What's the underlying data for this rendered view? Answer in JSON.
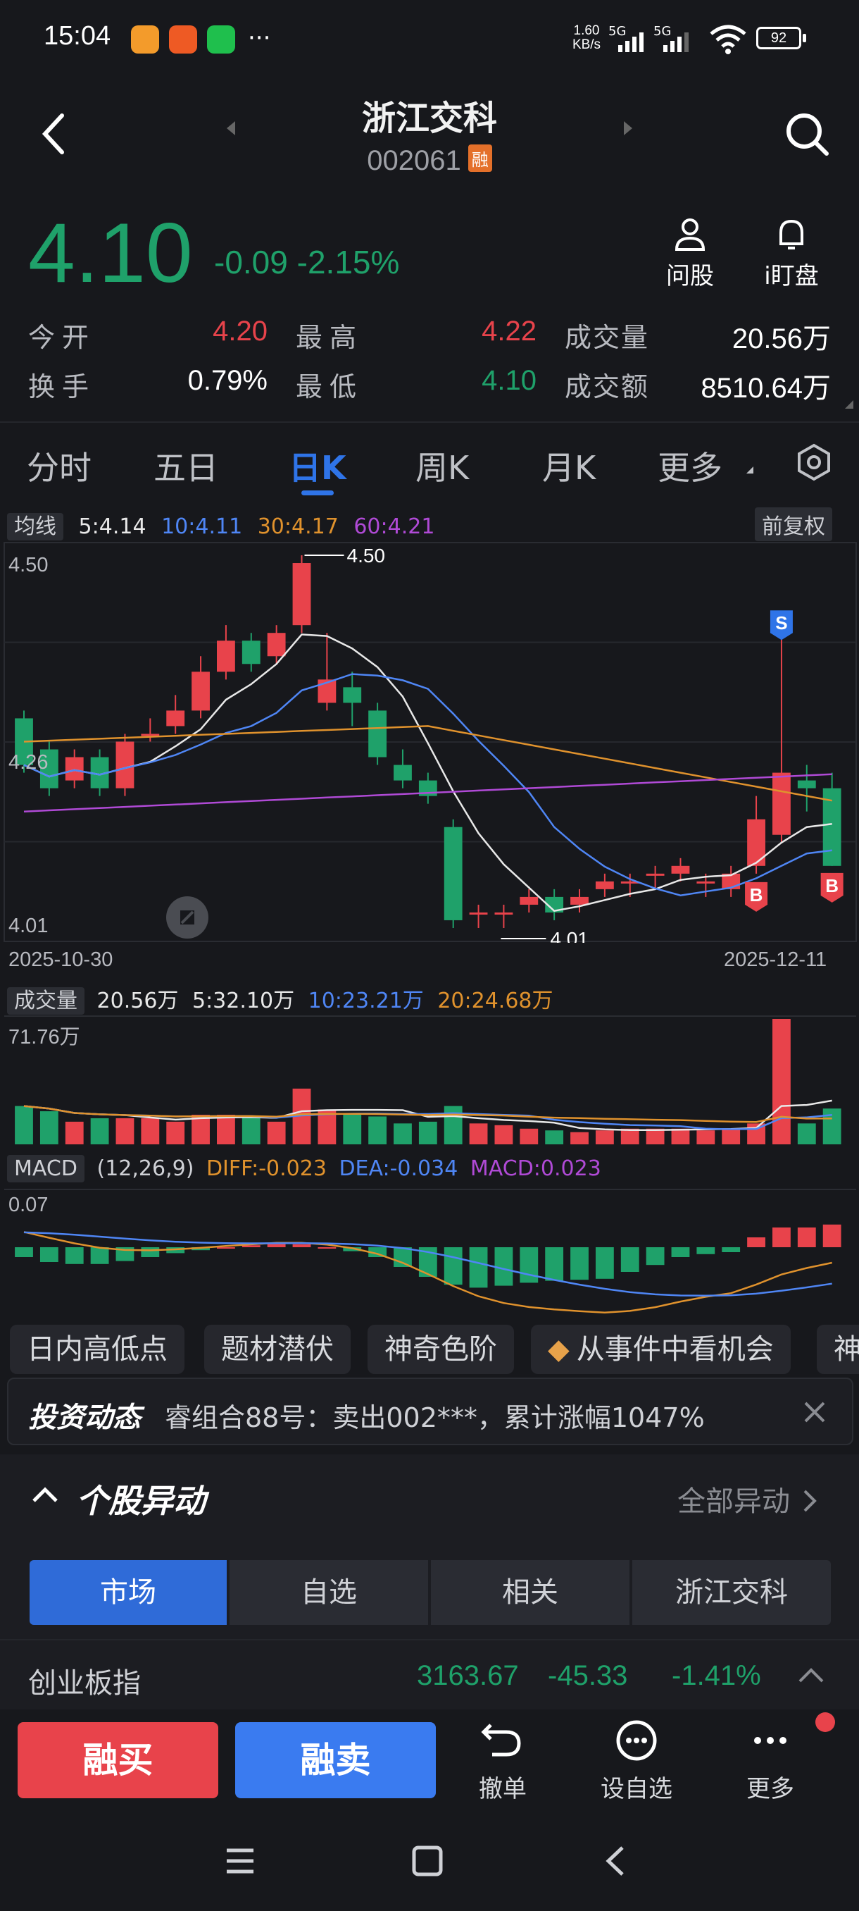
{
  "status_bar": {
    "time": "15:04",
    "more": "···",
    "net_speed_value": "1.60",
    "net_speed_unit": "KB/s",
    "signal1": "5G",
    "signal2": "5G",
    "battery": "92"
  },
  "header": {
    "stock_name": "浙江交科",
    "stock_code": "002061",
    "badge": "融"
  },
  "quote": {
    "price": "4.10",
    "change": "-0.09",
    "change_pct": "-2.15%",
    "ask_label": "问股",
    "watch_label": "i盯盘",
    "open_label": "今开",
    "open_value": "4.20",
    "high_label": "最高",
    "high_value": "4.22",
    "volume_label": "成交量",
    "volume_value": "20.56万",
    "turnover_label": "换手",
    "turnover_value": "0.79%",
    "low_label": "最低",
    "low_value": "4.10",
    "amount_label": "成交额",
    "amount_value": "8510.64万"
  },
  "period_tabs": [
    "分时",
    "五日",
    "日K",
    "周K",
    "月K",
    "更多"
  ],
  "active_tab": 2,
  "kline_bar": {
    "ma_chip": "均线",
    "ma5": "5:4.14",
    "ma10": "10:4.11",
    "ma30": "30:4.17",
    "ma60": "60:4.21",
    "adjust": "前复权"
  },
  "volume_bar": {
    "chip": "成交量",
    "vol": "20.56万",
    "v5": "5:32.10万",
    "v10": "10:23.21万",
    "v20": "20:24.68万",
    "max_label": "71.76万"
  },
  "macd_bar": {
    "chip": "MACD",
    "params": "(12,26,9)",
    "diff": "DIFF:-0.023",
    "dea": "DEA:-0.034",
    "macd": "MACD:0.023",
    "top_label": "0.07"
  },
  "chart_data": {
    "type": "candlestick",
    "title": "",
    "x_start": "2025-10-30",
    "x_end": "2025-12-11",
    "y_ticks": [
      "4.50",
      "4.26",
      "4.01"
    ],
    "ylim": [
      4.01,
      4.5
    ],
    "max_marker": "4.50",
    "min_marker": "4.01",
    "markers": [
      "S",
      "B",
      "B"
    ],
    "candles": [
      {
        "o": 4.29,
        "c": 4.23,
        "h": 4.3,
        "l": 4.22
      },
      {
        "o": 4.25,
        "c": 4.2,
        "h": 4.26,
        "l": 4.19
      },
      {
        "o": 4.21,
        "c": 4.24,
        "h": 4.25,
        "l": 4.2
      },
      {
        "o": 4.24,
        "c": 4.2,
        "h": 4.25,
        "l": 4.19
      },
      {
        "o": 4.2,
        "c": 4.26,
        "h": 4.27,
        "l": 4.19
      },
      {
        "o": 4.27,
        "c": 4.27,
        "h": 4.29,
        "l": 4.26
      },
      {
        "o": 4.28,
        "c": 4.3,
        "h": 4.32,
        "l": 4.27
      },
      {
        "o": 4.3,
        "c": 4.35,
        "h": 4.37,
        "l": 4.29
      },
      {
        "o": 4.35,
        "c": 4.39,
        "h": 4.41,
        "l": 4.34
      },
      {
        "o": 4.39,
        "c": 4.36,
        "h": 4.4,
        "l": 4.35
      },
      {
        "o": 4.37,
        "c": 4.4,
        "h": 4.41,
        "l": 4.36
      },
      {
        "o": 4.41,
        "c": 4.49,
        "h": 4.5,
        "l": 4.4
      },
      {
        "o": 4.31,
        "c": 4.34,
        "h": 4.4,
        "l": 4.3
      },
      {
        "o": 4.33,
        "c": 4.31,
        "h": 4.35,
        "l": 4.28
      },
      {
        "o": 4.3,
        "c": 4.24,
        "h": 4.31,
        "l": 4.23
      },
      {
        "o": 4.23,
        "c": 4.21,
        "h": 4.25,
        "l": 4.2
      },
      {
        "o": 4.21,
        "c": 4.19,
        "h": 4.22,
        "l": 4.18
      },
      {
        "o": 4.15,
        "c": 4.03,
        "h": 4.16,
        "l": 4.02
      },
      {
        "o": 4.04,
        "c": 4.04,
        "h": 4.05,
        "l": 4.02
      },
      {
        "o": 4.04,
        "c": 4.04,
        "h": 4.05,
        "l": 4.02
      },
      {
        "o": 4.05,
        "c": 4.06,
        "h": 4.07,
        "l": 4.04
      },
      {
        "o": 4.06,
        "c": 4.04,
        "h": 4.07,
        "l": 4.03
      },
      {
        "o": 4.05,
        "c": 4.06,
        "h": 4.07,
        "l": 4.04
      },
      {
        "o": 4.07,
        "c": 4.08,
        "h": 4.09,
        "l": 4.06
      },
      {
        "o": 4.08,
        "c": 4.08,
        "h": 4.09,
        "l": 4.06
      },
      {
        "o": 4.09,
        "c": 4.09,
        "h": 4.1,
        "l": 4.07
      },
      {
        "o": 4.09,
        "c": 4.1,
        "h": 4.11,
        "l": 4.08
      },
      {
        "o": 4.08,
        "c": 4.08,
        "h": 4.09,
        "l": 4.06
      },
      {
        "o": 4.07,
        "c": 4.09,
        "h": 4.1,
        "l": 4.06
      },
      {
        "o": 4.1,
        "c": 4.16,
        "h": 4.19,
        "l": 4.09
      },
      {
        "o": 4.14,
        "c": 4.22,
        "h": 4.4,
        "l": 4.13
      },
      {
        "o": 4.21,
        "c": 4.2,
        "h": 4.23,
        "l": 4.17
      },
      {
        "o": 4.2,
        "c": 4.1,
        "h": 4.22,
        "l": 4.1
      }
    ],
    "volumes": [
      22,
      19,
      13,
      15,
      15,
      15,
      13,
      17,
      17,
      16,
      13,
      32,
      20,
      18,
      16,
      12,
      13,
      22,
      12,
      11,
      9,
      8,
      7,
      8,
      9,
      9,
      9,
      8,
      9,
      12,
      72,
      12,
      20.56
    ],
    "macd_hist": [
      -0.01,
      -0.015,
      -0.017,
      -0.017,
      -0.014,
      -0.01,
      -0.006,
      -0.003,
      0.0,
      0.002,
      0.004,
      0.003,
      0.0,
      -0.004,
      -0.01,
      -0.02,
      -0.03,
      -0.038,
      -0.041,
      -0.039,
      -0.036,
      -0.034,
      -0.033,
      -0.032,
      -0.025,
      -0.018,
      -0.01,
      -0.007,
      -0.005,
      0.01,
      0.02,
      0.02,
      0.023
    ]
  },
  "features": [
    "日内高低点",
    "题材潜伏",
    "神奇色阶",
    "从事件中看机会",
    "神"
  ],
  "news": {
    "tag": "投资动态",
    "text": "睿组合88号：卖出002***，累计涨幅1047%"
  },
  "section": {
    "title": "个股异动",
    "link": "全部异动",
    "tabs": [
      "市场",
      "自选",
      "相关",
      "浙江交科"
    ],
    "active": 0
  },
  "index_row": {
    "name": "创业板指",
    "value": "3163.67",
    "change": "-45.33",
    "pct": "-1.41%"
  },
  "bottom_bar": {
    "buy": "融买",
    "sell": "融卖",
    "cancel": "撤单",
    "watchlist": "设自选",
    "more": "更多"
  },
  "colors": {
    "up": "#e8434b",
    "down": "#1fa16a",
    "accent": "#2f74e8",
    "ma5": "#e8e8e8",
    "ma10": "#4f86f5",
    "ma30": "#e0922d",
    "ma60": "#b04ad6"
  }
}
